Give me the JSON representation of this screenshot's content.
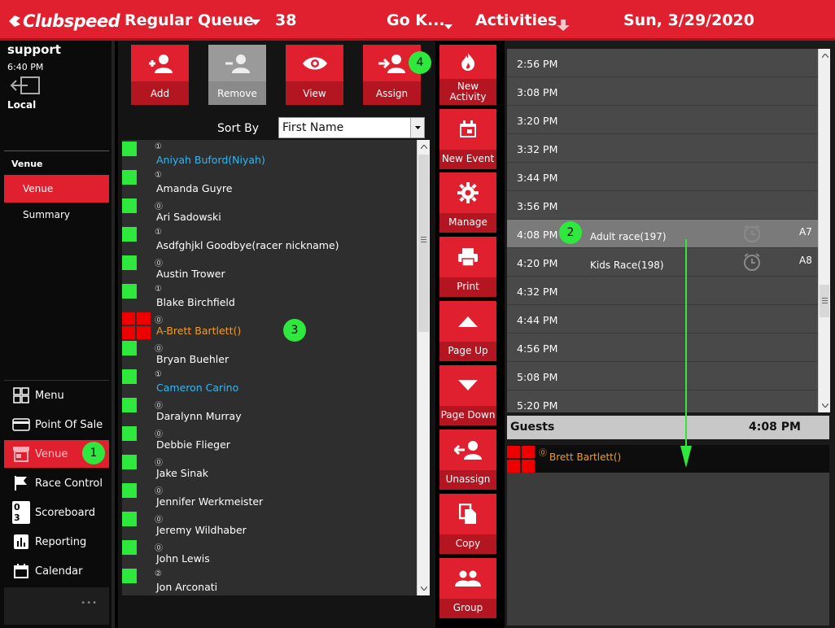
{
  "topbar": {
    "logo": "Clubspeed",
    "queue": "Regular Queue",
    "queue_count": "38",
    "track": "Go K...",
    "activities": "Activities",
    "date": "Sun, 3/29/2020"
  },
  "sidebar": {
    "user": "support",
    "time": "6:40 PM",
    "location": "Local",
    "section_title": "Venue",
    "sub_items": [
      {
        "label": "Venue"
      },
      {
        "label": "Summary"
      }
    ],
    "nav": [
      {
        "label": "Menu",
        "icon": "grid-icon"
      },
      {
        "label": "Point Of Sale",
        "icon": "card-icon"
      },
      {
        "label": "Venue",
        "icon": "store-icon"
      },
      {
        "label": "Race Control",
        "icon": "flag-icon"
      },
      {
        "label": "Scoreboard",
        "icon": "scoreboard-icon"
      },
      {
        "label": "Reporting",
        "icon": "chart-icon"
      },
      {
        "label": "Calendar",
        "icon": "calendar-icon"
      }
    ],
    "more": "•••",
    "scoreboard_glyph": "0 3"
  },
  "toolbar": {
    "add": "Add",
    "remove": "Remove",
    "view": "View",
    "assign": "Assign"
  },
  "sort": {
    "label": "Sort By",
    "value": "First Name"
  },
  "racers": [
    {
      "num": "①",
      "name": "Aniyah Buford(Niyah)",
      "color": "blue",
      "status": "green"
    },
    {
      "num": "①",
      "name": "Amanda Guyre",
      "color": "white",
      "status": "green"
    },
    {
      "num": "⓪",
      "name": "Ari Sadowski",
      "color": "white",
      "status": "green"
    },
    {
      "num": "①",
      "name": "Asdfghjkl Goodbye(racer nickname)",
      "color": "white",
      "status": "green"
    },
    {
      "num": "⓪",
      "name": "Austin Trower",
      "color": "white",
      "status": "green"
    },
    {
      "num": "①",
      "name": "Blake Birchfield",
      "color": "white",
      "status": "green"
    },
    {
      "num": "⓪",
      "name": "A-Brett Bartlett()",
      "color": "orange",
      "status": "red"
    },
    {
      "num": "⓪",
      "name": "Bryan Buehler",
      "color": "white",
      "status": "green"
    },
    {
      "num": "①",
      "name": "Cameron Carino",
      "color": "blue",
      "status": "green"
    },
    {
      "num": "⓪",
      "name": "Daralynn Murray",
      "color": "white",
      "status": "green"
    },
    {
      "num": "⓪",
      "name": "Debbie Flieger",
      "color": "white",
      "status": "green"
    },
    {
      "num": "⓪",
      "name": "Jake Sinak",
      "color": "white",
      "status": "green"
    },
    {
      "num": "⓪",
      "name": "Jennifer Werkmeister",
      "color": "white",
      "status": "green"
    },
    {
      "num": "⓪",
      "name": "Jeremy Wildhaber",
      "color": "white",
      "status": "green"
    },
    {
      "num": "⓪",
      "name": "John Lewis",
      "color": "white",
      "status": "green"
    },
    {
      "num": "②",
      "name": "Jon Arconati",
      "color": "white",
      "status": "green"
    }
  ],
  "actions": [
    {
      "label": "New Activity",
      "icon": "flame-icon"
    },
    {
      "label": "New Event",
      "icon": "calendar-icon"
    },
    {
      "label": "Manage",
      "icon": "gear-icon"
    },
    {
      "label": "Print",
      "icon": "printer-icon"
    },
    {
      "label": "Page Up",
      "icon": "arrow-up-icon"
    },
    {
      "label": "Page Down",
      "icon": "arrow-down-icon"
    },
    {
      "label": "Unassign",
      "icon": "user-remove-icon"
    },
    {
      "label": "Copy",
      "icon": "copy-icon"
    },
    {
      "label": "Group",
      "icon": "group-icon"
    }
  ],
  "schedule": {
    "slots": [
      "2:56 PM",
      "3:08 PM",
      "3:20 PM",
      "3:32 PM",
      "3:44 PM",
      "3:56 PM",
      "4:08 PM",
      "4:20 PM",
      "4:32 PM",
      "4:44 PM",
      "4:56 PM",
      "5:08 PM",
      "5:20 PM"
    ],
    "events": [
      {
        "name": "Adult race(197)",
        "track": "A7",
        "slot": "4:08 PM"
      },
      {
        "name": "Kids Race(198)",
        "track": "A8",
        "slot": "4:20 PM"
      }
    ]
  },
  "guests": {
    "title": "Guests",
    "time": "4:08 PM",
    "items": [
      {
        "num": "⓪",
        "name": "Brett Bartlett()"
      }
    ]
  },
  "markers": [
    "1",
    "2",
    "3",
    "4"
  ],
  "colors": {
    "brand_red": "#e0202e",
    "status_green": "#2ee83d",
    "name_blue": "#35b6f0",
    "name_orange": "#f39c20"
  }
}
